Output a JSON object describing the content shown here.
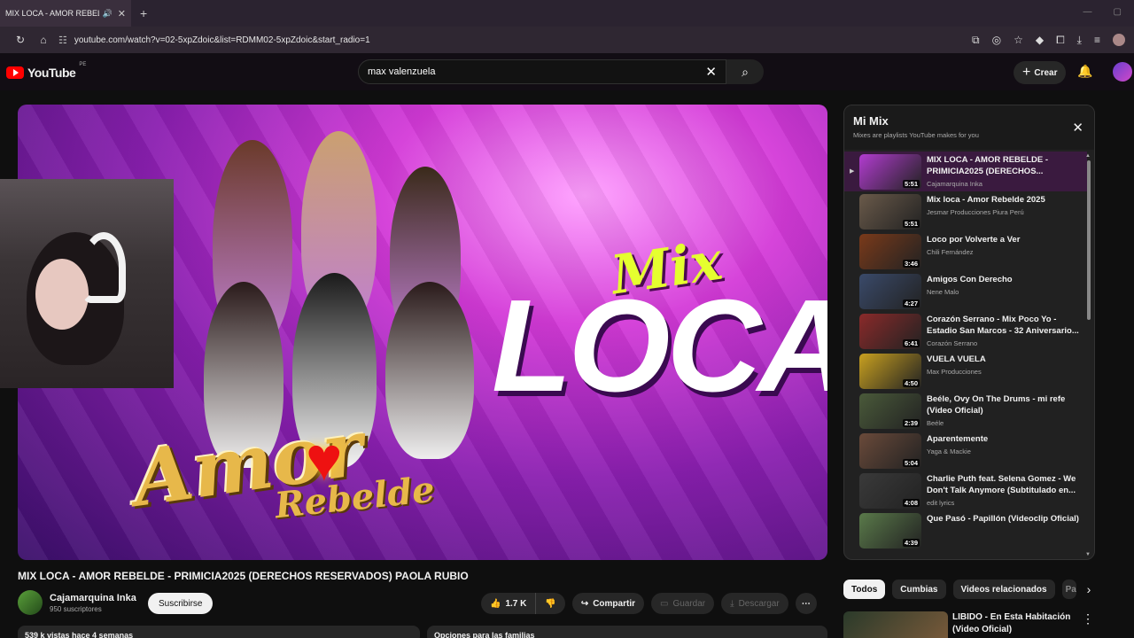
{
  "browser": {
    "tab_title": "MIX LOCA - AMOR REBELDE",
    "url": "youtube.com/watch?v=02-5xpZdoic&list=RDMM02-5xpZdoic&start_radio=1"
  },
  "header": {
    "logo_text": "YouTube",
    "country_code": "PE",
    "search_value": "max valenzuela",
    "create_label": "Crear"
  },
  "video": {
    "mix_text": "Mix",
    "loca_text": "LOCA",
    "brand_text": "Amor",
    "brand_sub": "Rebelde",
    "title": "MIX LOCA - AMOR REBELDE - PRIMICIA2025 (DERECHOS RESERVADOS) PAOLA RUBIO",
    "channel": "Cajamarquina Inka",
    "subscribers": "950 suscriptores",
    "subscribe_label": "Suscribirse",
    "likes": "1.7 K",
    "share_label": "Compartir",
    "save_label": "Guardar",
    "download_label": "Descargar",
    "views_line": "539 k vistas  hace 4 semanas",
    "family_line": "Opciones para las familias"
  },
  "mix": {
    "title": "Mi Mix",
    "subtitle": "Mixes are playlists YouTube makes for you",
    "items": [
      {
        "title": "MIX LOCA - AMOR REBELDE - PRIMICIA2025 (DERECHOS...",
        "channel": "Cajamarquina Inka",
        "duration": "5:51",
        "color": "#b23cd0"
      },
      {
        "title": "Mix loca - Amor Rebelde 2025",
        "channel": "Jesmar Producciones Piura Perú",
        "duration": "5:51",
        "color": "#6a5a4a"
      },
      {
        "title": "Loco por Volverte a Ver",
        "channel": "Chili Fernández",
        "duration": "3:46",
        "color": "#7a3a1a"
      },
      {
        "title": "Amigos Con Derecho",
        "channel": "Nene Malo",
        "duration": "4:27",
        "color": "#3a4a6a"
      },
      {
        "title": "Corazón Serrano - Mix Poco Yo - Estadio San Marcos - 32 Aniversario...",
        "channel": "Corazón Serrano",
        "duration": "6:41",
        "color": "#8a2a2a"
      },
      {
        "title": "VUELA VUELA",
        "channel": "Max Producciones",
        "duration": "4:50",
        "color": "#c8a020"
      },
      {
        "title": "Beéle, Ovy On The Drums - mi refe (Video Oficial)",
        "channel": "Beéle",
        "duration": "2:39",
        "color": "#4a5a3a"
      },
      {
        "title": "Aparentemente",
        "channel": "Yaga & Mackie",
        "duration": "5:04",
        "color": "#6a4a3a"
      },
      {
        "title": "Charlie Puth feat. Selena Gomez - We Don't Talk Anymore (Subtitulado en...",
        "channel": "edit lyrics",
        "duration": "4:08",
        "color": "#3a3a3a"
      },
      {
        "title": "Que Pasó - Papillón (Videoclip Oficial)",
        "channel": "",
        "duration": "4:39",
        "color": "#5a7a4a"
      }
    ]
  },
  "chips": [
    "Todos",
    "Cumbias",
    "Videos relacionados",
    "Pa"
  ],
  "recommendation": {
    "title": "LIBIDO - En Esta Habitación (Video Oficial)"
  }
}
